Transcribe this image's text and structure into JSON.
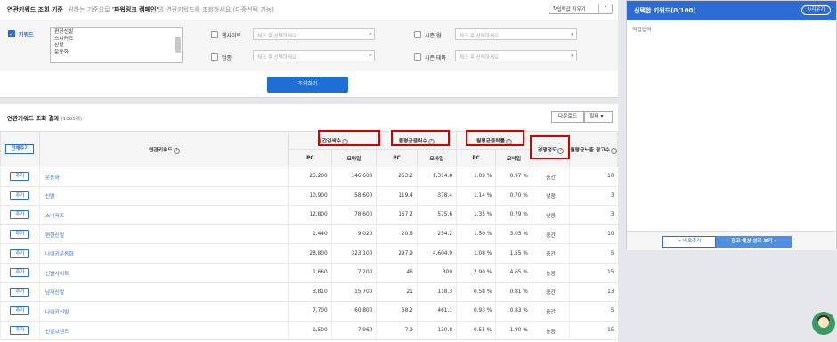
{
  "header": {
    "title": "연관키워드 조회 기준",
    "desc_pre": "원하는 기준으로",
    "desc_brand": "'파워링크 캠페인'",
    "desc_post": "의 연관키워드를 조회하세요.(다중선택 가능)",
    "clear_label": "입력값 지우기"
  },
  "filters": {
    "keyword_label": "키워드",
    "keywords": [
      "편한신발",
      "스니커즈",
      "신발",
      "운동화"
    ],
    "website_label": "웹사이트",
    "website_placeholder": "체크 후 선택하세요",
    "business_label": "업종",
    "business_placeholder": "체크 후 선택하세요",
    "season_month_label": "시즌 월",
    "season_month_placeholder": "체크 후 선택하세요",
    "season_theme_label": "시즌 테마",
    "season_theme_placeholder": "체크 후 선택하세요",
    "search_button": "조회하기"
  },
  "results": {
    "title": "연관키워드 조회 결과",
    "count": "(1000개)",
    "download": "다운로드",
    "filter": "필터",
    "add_all": "전체추가",
    "col_keyword": "연관키워드",
    "col_search": "월간검색수",
    "col_clicks": "월평균클릭수",
    "col_ctr": "월평균클릭률",
    "col_comp": "경쟁정도",
    "col_ads": "월평균노출 광고수",
    "pc": "PC",
    "mobile": "모바일",
    "add_label": "추가",
    "rows": [
      {
        "kw": "운동화",
        "s_pc": "25,200",
        "s_mo": "146,600",
        "c_pc": "263.2",
        "c_mo": "1,314.8",
        "r_pc": "1.09 %",
        "r_mo": "0.97 %",
        "comp": "중간",
        "ads": "10"
      },
      {
        "kw": "신발",
        "s_pc": "10,900",
        "s_mo": "58,600",
        "c_pc": "119.4",
        "c_mo": "378.4",
        "r_pc": "1.14 %",
        "r_mo": "0.70 %",
        "comp": "낮음",
        "ads": "3"
      },
      {
        "kw": "스니커즈",
        "s_pc": "12,800",
        "s_mo": "78,600",
        "c_pc": "167.2",
        "c_mo": "575.6",
        "r_pc": "1.35 %",
        "r_mo": "0.79 %",
        "comp": "낮음",
        "ads": "3"
      },
      {
        "kw": "편한신발",
        "s_pc": "1,440",
        "s_mo": "9,020",
        "c_pc": "20.8",
        "c_mo": "254.2",
        "r_pc": "1.50 %",
        "r_mo": "3.03 %",
        "comp": "중간",
        "ads": "10"
      },
      {
        "kw": "나이키운동화",
        "s_pc": "28,800",
        "s_mo": "323,100",
        "c_pc": "297.9",
        "c_mo": "4,604.9",
        "r_pc": "1.08 %",
        "r_mo": "1.55 %",
        "comp": "중간",
        "ads": "5"
      },
      {
        "kw": "신발사이트",
        "s_pc": "1,660",
        "s_mo": "7,200",
        "c_pc": "46",
        "c_mo": "309",
        "r_pc": "2.90 %",
        "r_mo": "4.65 %",
        "comp": "높음",
        "ads": "15"
      },
      {
        "kw": "남자신발",
        "s_pc": "3,810",
        "s_mo": "15,700",
        "c_pc": "21",
        "c_mo": "118.3",
        "r_pc": "0.58 %",
        "r_mo": "0.81 %",
        "comp": "중간",
        "ads": "13"
      },
      {
        "kw": "나이키신발",
        "s_pc": "7,700",
        "s_mo": "60,800",
        "c_pc": "68.2",
        "c_mo": "461.1",
        "r_pc": "0.93 %",
        "r_mo": "0.83 %",
        "comp": "중간",
        "ads": "5"
      },
      {
        "kw": "신발브랜드",
        "s_pc": "1,500",
        "s_mo": "7,960",
        "c_pc": "7.9",
        "c_mo": "130.8",
        "r_pc": "0.55 %",
        "r_mo": "1.80 %",
        "comp": "높음",
        "ads": "15"
      }
    ]
  },
  "selected": {
    "title": "선택한 키워드(0/100)",
    "clear": "지우기",
    "direct": "직접입력",
    "bulk_add": "+ 바로추가",
    "view": "광고 예상 성과 보기 ›"
  }
}
